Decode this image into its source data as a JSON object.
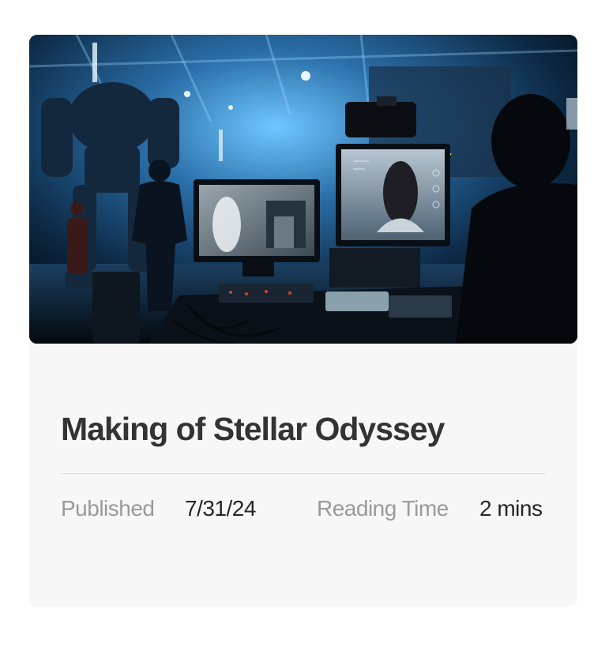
{
  "article": {
    "title": "Making of Stellar Odyssey",
    "image_alt": "Film studio with robots and monitors",
    "meta": {
      "published_label": "Published",
      "published_value": "7/31/24",
      "reading_label": "Reading Time",
      "reading_value": "2 mins"
    }
  },
  "colors": {
    "card_bg": "#f7f7f8",
    "title": "#333333",
    "label": "#9a9a9a",
    "value": "#262626"
  }
}
